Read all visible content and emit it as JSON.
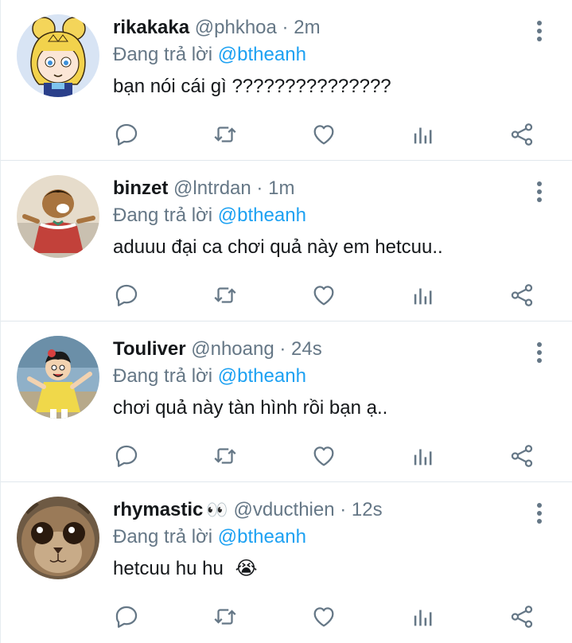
{
  "tweets": [
    {
      "name": "rikakaka",
      "handle": "@phkhoa",
      "time": "2m",
      "reply_prefix": "Đang trả lời",
      "reply_to": "@btheanh",
      "text": "bạn nói cái gì ???????????????",
      "avatar": "cartoon-princess-avatar"
    },
    {
      "name": "binzet",
      "handle": "@lntrdan",
      "time": "1m",
      "reply_prefix": "Đang trả lời",
      "reply_to": "@btheanh",
      "text": "aduuu đại ca chơi quả này em hetcuu..",
      "avatar": "cartoon-man-in-dress-avatar"
    },
    {
      "name": "Touliver",
      "handle": "@nhoang",
      "time": "24s",
      "reply_prefix": "Đang trả lời",
      "reply_to": "@btheanh",
      "text": "chơi quả này tàn hình rồi bạn ạ..",
      "avatar": "cartoon-boy-in-dress-avatar"
    },
    {
      "name": "rhymastic",
      "name_emoji": "👀",
      "handle": "@vducthien",
      "time": "12s",
      "reply_prefix": "Đang trả lời",
      "reply_to": "@btheanh",
      "text": "hetcuu hu hu",
      "text_emoji": "😭",
      "avatar": "cat-face-avatar"
    }
  ],
  "icons": {
    "reply": "reply-icon",
    "retweet": "retweet-icon",
    "like": "heart-icon",
    "stats": "stats-icon",
    "share": "share-icon",
    "more": "more-vertical-icon"
  },
  "colors": {
    "name": "#14171a",
    "secondary": "#657786",
    "mention": "#1da1f2",
    "divider": "#e1e8ed"
  }
}
